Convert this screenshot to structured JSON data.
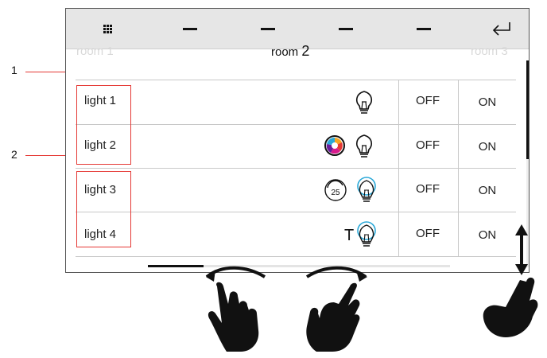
{
  "toolbar": {
    "menu_icon": "grid-icon",
    "dash_buttons": [
      "dash",
      "dash",
      "dash",
      "dash"
    ],
    "back_icon": "return-arrow-icon"
  },
  "rooms": {
    "prev": "room 1",
    "current_prefix": "room ",
    "current_number": "2",
    "next": "room 3"
  },
  "rows": [
    {
      "label": "light 1",
      "icons": [
        "bulb-icon"
      ],
      "off": "OFF",
      "on": "ON"
    },
    {
      "label": "light 2",
      "icons": [
        "color-wheel-icon",
        "bulb-icon"
      ],
      "off": "OFF",
      "on": "ON"
    },
    {
      "label": "light 3",
      "icons": [
        "dimmer-icon",
        "bulb-blue-icon"
      ],
      "dimmer_value": "25",
      "off": "OFF",
      "on": "ON"
    },
    {
      "label": "light 4",
      "icons": [
        "temperature-T-icon",
        "bulb-blue-icon"
      ],
      "tlabel": "T",
      "off": "OFF",
      "on": "ON"
    }
  ],
  "callouts": [
    "1",
    "2"
  ],
  "colors": {
    "accent_red": "#e53935",
    "bulb_blue": "#29a8d8"
  }
}
